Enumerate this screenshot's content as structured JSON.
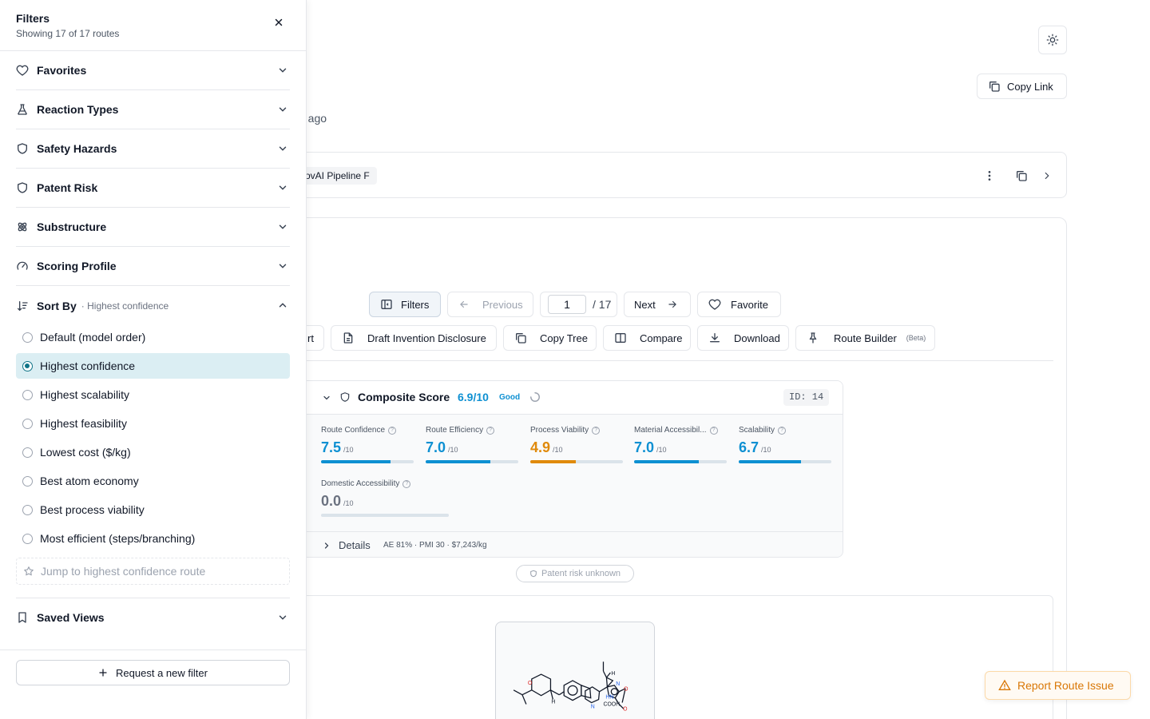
{
  "header": {
    "copy_link_label": "Copy Link",
    "meta_text": "ays ago"
  },
  "pipeline": {
    "badge": "ovAI Pipeline F"
  },
  "toolbar": {
    "filters_label": "Filters",
    "previous_label": "Previous",
    "page_value": "1",
    "page_total": "/ 17",
    "next_label": "Next",
    "favorite_label": "Favorite",
    "export_partial": "rt",
    "draft_label": "Draft Invention Disclosure",
    "copy_tree_label": "Copy Tree",
    "compare_label": "Compare",
    "download_label": "Download",
    "route_builder_label": "Route Builder",
    "beta_label": "(Beta)"
  },
  "score": {
    "title": "Composite Score",
    "value": "6.9/10",
    "rating": "Good",
    "id_label": "ID: 14",
    "metrics": [
      {
        "label": "Route Confidence",
        "value": "7.5",
        "unit": "/10",
        "fraction": 0.75,
        "color": "#0e90d2"
      },
      {
        "label": "Route Efficiency",
        "value": "7.0",
        "unit": "/10",
        "fraction": 0.7,
        "color": "#0e90d2"
      },
      {
        "label": "Process Viability",
        "value": "4.9",
        "unit": "/10",
        "fraction": 0.49,
        "color": "#e08a0b"
      },
      {
        "label": "Material Accessibil...",
        "value": "7.0",
        "unit": "/10",
        "fraction": 0.7,
        "color": "#0e90d2"
      },
      {
        "label": "Scalability",
        "value": "6.7",
        "unit": "/10",
        "fraction": 0.67,
        "color": "#0e90d2"
      },
      {
        "label": "Domestic Accessibility",
        "value": "0.0",
        "unit": "/10",
        "fraction": 0.0,
        "color": "#6b7280"
      }
    ],
    "details_label": "Details",
    "details_summary": "AE 81% · PMI 30 · $7,243/kg"
  },
  "patent_pill": "Patent risk unknown",
  "report_label": "Report Route Issue",
  "drawer": {
    "title": "Filters",
    "subtitle": "Showing 17 of 17 routes",
    "sections": [
      {
        "label": "Favorites",
        "icon": "heart-icon"
      },
      {
        "label": "Reaction Types",
        "icon": "flask-icon"
      },
      {
        "label": "Safety Hazards",
        "icon": "shield-icon"
      },
      {
        "label": "Patent Risk",
        "icon": "shield-icon"
      },
      {
        "label": "Substructure",
        "icon": "atom-icon"
      },
      {
        "label": "Scoring Profile",
        "icon": "gauge-icon"
      }
    ],
    "sort": {
      "label": "Sort By",
      "note": "· Highest confidence",
      "options": [
        "Default (model order)",
        "Highest confidence",
        "Highest scalability",
        "Highest feasibility",
        "Lowest cost ($/kg)",
        "Best atom economy",
        "Best process viability",
        "Most efficient (steps/branching)"
      ],
      "selected_index": 1,
      "jump_placeholder": "Jump to highest confidence route"
    },
    "saved_views_label": "Saved Views",
    "request_label": "Request a new filter"
  },
  "colors": {
    "accent": "#0e90d2",
    "selected_bg": "#dbeef3",
    "radio_selected": "#0f7487",
    "warning": "#d97706"
  }
}
